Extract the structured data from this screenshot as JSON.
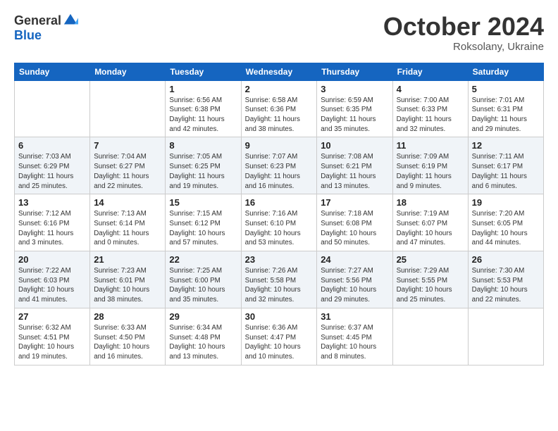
{
  "header": {
    "logo_general": "General",
    "logo_blue": "Blue",
    "month_title": "October 2024",
    "subtitle": "Roksolany, Ukraine"
  },
  "weekdays": [
    "Sunday",
    "Monday",
    "Tuesday",
    "Wednesday",
    "Thursday",
    "Friday",
    "Saturday"
  ],
  "weeks": [
    [
      {
        "day": "",
        "sunrise": "",
        "sunset": "",
        "daylight": ""
      },
      {
        "day": "",
        "sunrise": "",
        "sunset": "",
        "daylight": ""
      },
      {
        "day": "1",
        "sunrise": "Sunrise: 6:56 AM",
        "sunset": "Sunset: 6:38 PM",
        "daylight": "Daylight: 11 hours and 42 minutes."
      },
      {
        "day": "2",
        "sunrise": "Sunrise: 6:58 AM",
        "sunset": "Sunset: 6:36 PM",
        "daylight": "Daylight: 11 hours and 38 minutes."
      },
      {
        "day": "3",
        "sunrise": "Sunrise: 6:59 AM",
        "sunset": "Sunset: 6:35 PM",
        "daylight": "Daylight: 11 hours and 35 minutes."
      },
      {
        "day": "4",
        "sunrise": "Sunrise: 7:00 AM",
        "sunset": "Sunset: 6:33 PM",
        "daylight": "Daylight: 11 hours and 32 minutes."
      },
      {
        "day": "5",
        "sunrise": "Sunrise: 7:01 AM",
        "sunset": "Sunset: 6:31 PM",
        "daylight": "Daylight: 11 hours and 29 minutes."
      }
    ],
    [
      {
        "day": "6",
        "sunrise": "Sunrise: 7:03 AM",
        "sunset": "Sunset: 6:29 PM",
        "daylight": "Daylight: 11 hours and 25 minutes."
      },
      {
        "day": "7",
        "sunrise": "Sunrise: 7:04 AM",
        "sunset": "Sunset: 6:27 PM",
        "daylight": "Daylight: 11 hours and 22 minutes."
      },
      {
        "day": "8",
        "sunrise": "Sunrise: 7:05 AM",
        "sunset": "Sunset: 6:25 PM",
        "daylight": "Daylight: 11 hours and 19 minutes."
      },
      {
        "day": "9",
        "sunrise": "Sunrise: 7:07 AM",
        "sunset": "Sunset: 6:23 PM",
        "daylight": "Daylight: 11 hours and 16 minutes."
      },
      {
        "day": "10",
        "sunrise": "Sunrise: 7:08 AM",
        "sunset": "Sunset: 6:21 PM",
        "daylight": "Daylight: 11 hours and 13 minutes."
      },
      {
        "day": "11",
        "sunrise": "Sunrise: 7:09 AM",
        "sunset": "Sunset: 6:19 PM",
        "daylight": "Daylight: 11 hours and 9 minutes."
      },
      {
        "day": "12",
        "sunrise": "Sunrise: 7:11 AM",
        "sunset": "Sunset: 6:17 PM",
        "daylight": "Daylight: 11 hours and 6 minutes."
      }
    ],
    [
      {
        "day": "13",
        "sunrise": "Sunrise: 7:12 AM",
        "sunset": "Sunset: 6:16 PM",
        "daylight": "Daylight: 11 hours and 3 minutes."
      },
      {
        "day": "14",
        "sunrise": "Sunrise: 7:13 AM",
        "sunset": "Sunset: 6:14 PM",
        "daylight": "Daylight: 11 hours and 0 minutes."
      },
      {
        "day": "15",
        "sunrise": "Sunrise: 7:15 AM",
        "sunset": "Sunset: 6:12 PM",
        "daylight": "Daylight: 10 hours and 57 minutes."
      },
      {
        "day": "16",
        "sunrise": "Sunrise: 7:16 AM",
        "sunset": "Sunset: 6:10 PM",
        "daylight": "Daylight: 10 hours and 53 minutes."
      },
      {
        "day": "17",
        "sunrise": "Sunrise: 7:18 AM",
        "sunset": "Sunset: 6:08 PM",
        "daylight": "Daylight: 10 hours and 50 minutes."
      },
      {
        "day": "18",
        "sunrise": "Sunrise: 7:19 AM",
        "sunset": "Sunset: 6:07 PM",
        "daylight": "Daylight: 10 hours and 47 minutes."
      },
      {
        "day": "19",
        "sunrise": "Sunrise: 7:20 AM",
        "sunset": "Sunset: 6:05 PM",
        "daylight": "Daylight: 10 hours and 44 minutes."
      }
    ],
    [
      {
        "day": "20",
        "sunrise": "Sunrise: 7:22 AM",
        "sunset": "Sunset: 6:03 PM",
        "daylight": "Daylight: 10 hours and 41 minutes."
      },
      {
        "day": "21",
        "sunrise": "Sunrise: 7:23 AM",
        "sunset": "Sunset: 6:01 PM",
        "daylight": "Daylight: 10 hours and 38 minutes."
      },
      {
        "day": "22",
        "sunrise": "Sunrise: 7:25 AM",
        "sunset": "Sunset: 6:00 PM",
        "daylight": "Daylight: 10 hours and 35 minutes."
      },
      {
        "day": "23",
        "sunrise": "Sunrise: 7:26 AM",
        "sunset": "Sunset: 5:58 PM",
        "daylight": "Daylight: 10 hours and 32 minutes."
      },
      {
        "day": "24",
        "sunrise": "Sunrise: 7:27 AM",
        "sunset": "Sunset: 5:56 PM",
        "daylight": "Daylight: 10 hours and 29 minutes."
      },
      {
        "day": "25",
        "sunrise": "Sunrise: 7:29 AM",
        "sunset": "Sunset: 5:55 PM",
        "daylight": "Daylight: 10 hours and 25 minutes."
      },
      {
        "day": "26",
        "sunrise": "Sunrise: 7:30 AM",
        "sunset": "Sunset: 5:53 PM",
        "daylight": "Daylight: 10 hours and 22 minutes."
      }
    ],
    [
      {
        "day": "27",
        "sunrise": "Sunrise: 6:32 AM",
        "sunset": "Sunset: 4:51 PM",
        "daylight": "Daylight: 10 hours and 19 minutes."
      },
      {
        "day": "28",
        "sunrise": "Sunrise: 6:33 AM",
        "sunset": "Sunset: 4:50 PM",
        "daylight": "Daylight: 10 hours and 16 minutes."
      },
      {
        "day": "29",
        "sunrise": "Sunrise: 6:34 AM",
        "sunset": "Sunset: 4:48 PM",
        "daylight": "Daylight: 10 hours and 13 minutes."
      },
      {
        "day": "30",
        "sunrise": "Sunrise: 6:36 AM",
        "sunset": "Sunset: 4:47 PM",
        "daylight": "Daylight: 10 hours and 10 minutes."
      },
      {
        "day": "31",
        "sunrise": "Sunrise: 6:37 AM",
        "sunset": "Sunset: 4:45 PM",
        "daylight": "Daylight: 10 hours and 8 minutes."
      },
      {
        "day": "",
        "sunrise": "",
        "sunset": "",
        "daylight": ""
      },
      {
        "day": "",
        "sunrise": "",
        "sunset": "",
        "daylight": ""
      }
    ]
  ]
}
